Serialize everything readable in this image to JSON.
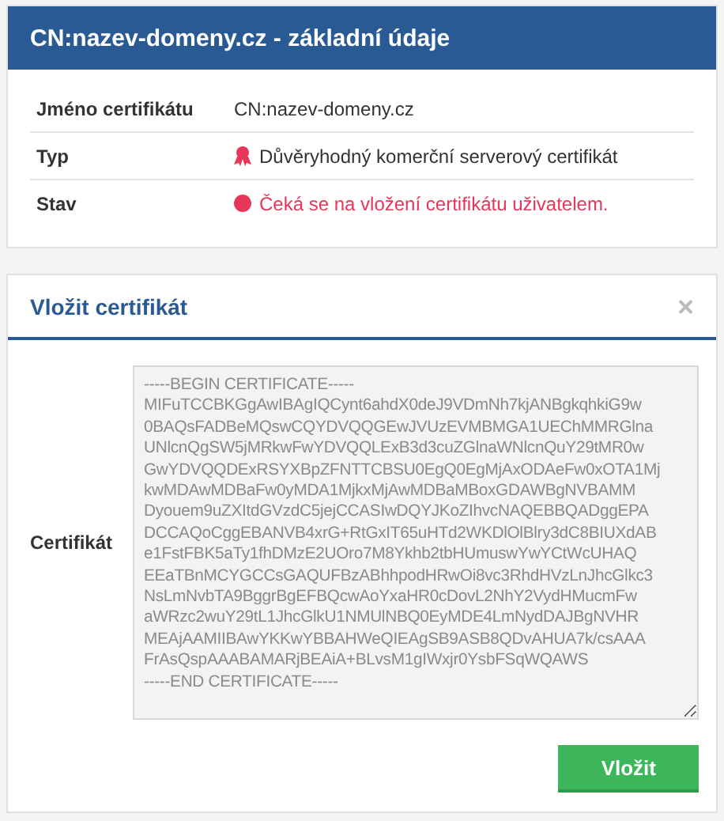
{
  "info_panel": {
    "title": "CN:nazev-domeny.cz - základní údaje",
    "rows": [
      {
        "kind": "text",
        "label": "Jméno certifikátu",
        "value": "CN:nazev-domeny.cz"
      },
      {
        "kind": "type",
        "label": "Typ",
        "value": "Důvěryhodný komerční serverový certifikát"
      },
      {
        "kind": "status",
        "label": "Stav",
        "value": "Čeká se na vložení certifikátu uživatelem.",
        "color": "#e8355a"
      }
    ]
  },
  "insert_panel": {
    "title": "Vložit certifikát",
    "close": "×",
    "field_label": "Certifikát",
    "certificate": {
      "disabled": true,
      "value_lines": [
        "-----BEGIN CERTIFICATE-----",
        "MIFuTCCBKGgAwIBAgIQCynt6ahdX0deJ9VDmNh7kjANBgkqhkiG9w",
        "0BAQsFADBeMQswCQYDVQQGEwJVUzEVMBMGA1UEChMMRGlna",
        "UNlcnQgSW5jMRkwFwYDVQQLExB3d3cuZGlnaWNlcnQuY29tMR0w",
        "GwYDVQQDExRSYXBpZFNTTCBSU0EgQ0EgMjAxODAeFw0xOTA1Mj",
        "kwMDAwMDBaFw0yMDA1MjkxMjAwMDBaMBoxGDAWBgNVBAMM",
        "Dyouem9uZXItdGVzdC5jejCCASIwDQYJKoZIhvcNAQEBBQADggEPA",
        "DCCAQoCggEBANVB4xrG+RtGxIT65uHTd2WKDlOlBlry3dC8BIUXdAB",
        "e1FstFBK5aTy1fhDMzE2UOro7M8Ykhb2tbHUmuswYwYCtWcUHAQ",
        "EEaTBnMCYGCCsGAQUFBzABhhpodHRwOi8vc3RhdHVzLnJhcGlkc3",
        "NsLmNvbTA9BggrBgEFBQcwAoYxaHR0cDovL2NhY2VydHMucmFw",
        "aWRzc2wuY29tL1JhcGlkU1NMUlNBQ0EyMDE4LmNydDAJBgNVHR",
        "MEAjAAMIIBAwYKKwYBBAHWeQIEAgSB9ASB8QDvAHUA7k/csAAA",
        "FrAsQspAAABAMARjBEAiA+BLvsM1gIWxjr0YsbFSqWQAWS",
        "-----END CERTIFICATE-----"
      ]
    },
    "submit": "Vložit"
  }
}
